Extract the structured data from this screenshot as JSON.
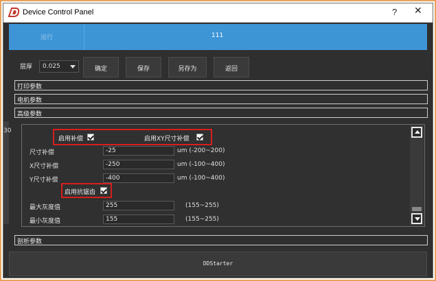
{
  "window": {
    "title": "Device Control Panel",
    "help_label": "?",
    "close_label": "✕",
    "logo_icon": "d-logo-icon"
  },
  "banner": {
    "left_label": "运行",
    "center_label": "111",
    "color": "#3d95d6"
  },
  "toolbar": {
    "layer_label": "层厚",
    "layer_value": "0.025",
    "confirm_label": "确定",
    "save_label": "保存",
    "save_as_label": "另存为",
    "back_label": "返回"
  },
  "sections": {
    "print_params": "打印参数",
    "motor_params": "电机参数",
    "advanced_params": "高级参数",
    "slice_params": "剖析参数"
  },
  "side": {
    "mark": "30"
  },
  "advanced": {
    "enable_compensation_label": "启用补偿",
    "enable_compensation_checked": true,
    "enable_xy_label": "启用XY尺寸补偿",
    "enable_xy_checked": true,
    "fields": [
      {
        "label": "尺寸补偿",
        "value": "-25",
        "range": "um (-200~200)"
      },
      {
        "label": "X尺寸补偿",
        "value": "-250",
        "range": "um (-100~400)"
      },
      {
        "label": "Y尺寸补偿",
        "value": "-400",
        "range": "um (-100~400)"
      }
    ],
    "antialias_label": "启用抗锯齿",
    "antialias_checked": true,
    "gray_fields": [
      {
        "label": "最大灰度值",
        "value": "255",
        "range": "(155~255)"
      },
      {
        "label": "最小灰度值",
        "value": "155",
        "range": "(155~255)"
      }
    ]
  },
  "footer": {
    "label": "DDStarter"
  },
  "highlight_color": "#d81e1e"
}
